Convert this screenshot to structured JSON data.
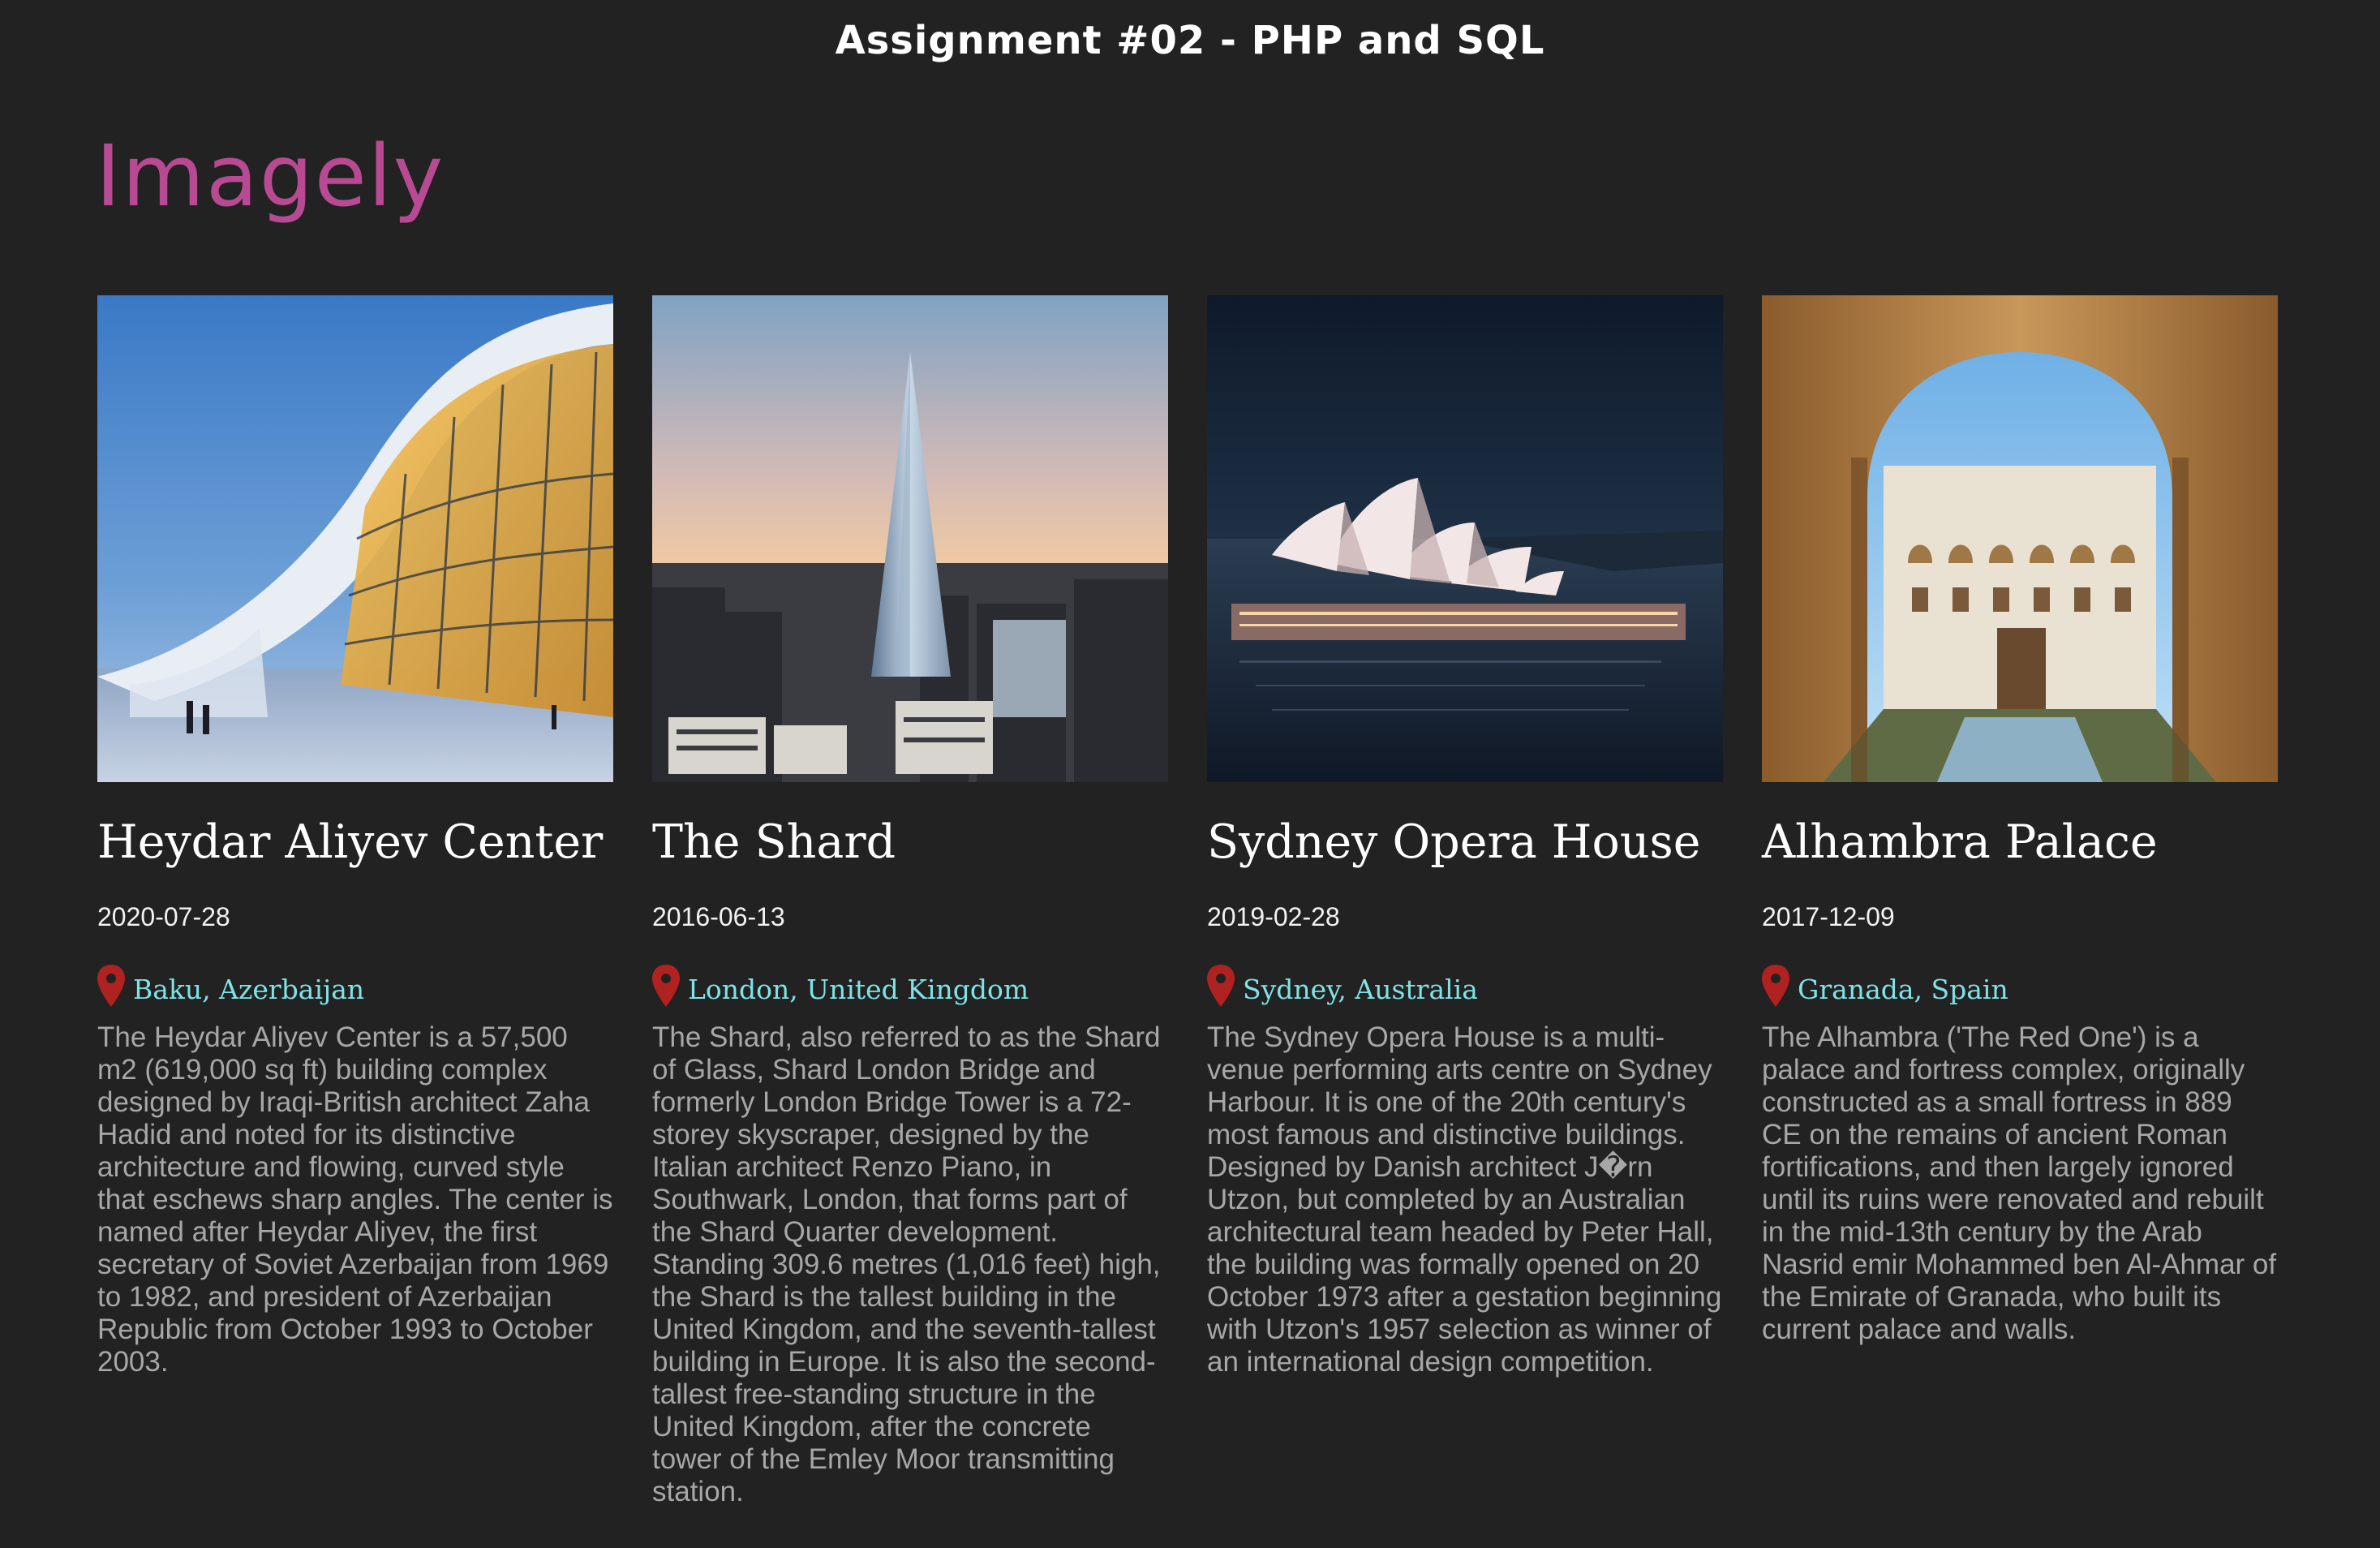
{
  "page": {
    "header": "Assignment #02 - PHP and SQL",
    "brand": "Imagely",
    "brand_color": "#b84a93",
    "location_color": "#7fe3e6",
    "pin_color": "#b0221f",
    "background": "#222222"
  },
  "cards": [
    {
      "title": "Heydar Aliyev Center",
      "date": "2020-07-28",
      "location": "Baku, Azerbaijan",
      "description": "The Heydar Aliyev Center is a 57,500 m2 (619,000 sq ft) building complex designed by Iraqi-British architect Zaha Hadid and noted for its distinctive architecture and flowing, curved style that eschews sharp angles. The center is named after Heydar Aliyev, the first secretary of Soviet Azerbaijan from 1969 to 1982, and president of Azerbaijan Republic from October 1993 to October 2003."
    },
    {
      "title": "The Shard",
      "date": "2016-06-13",
      "location": "London, United Kingdom",
      "description": "The Shard, also referred to as the Shard of Glass, Shard London Bridge and formerly London Bridge Tower is a 72-storey skyscraper, designed by the Italian architect Renzo Piano, in Southwark, London, that forms part of the Shard Quarter development. Standing 309.6 metres (1,016 feet) high, the Shard is the tallest building in the United Kingdom, and the seventh-tallest building in Europe. It is also the second-tallest free-standing structure in the United Kingdom, after the concrete tower of the Emley Moor transmitting station."
    },
    {
      "title": "Sydney Opera House",
      "date": "2019-02-28",
      "location": "Sydney, Australia",
      "description": "The Sydney Opera House is a multi-venue performing arts centre on Sydney Harbour. It is one of the 20th century's most famous and distinctive buildings. Designed by Danish architect J�rn Utzon, but completed by an Australian architectural team headed by Peter Hall, the building was formally opened on 20 October 1973 after a gestation beginning with Utzon's 1957 selection as winner of an international design competition."
    },
    {
      "title": "Alhambra Palace",
      "date": "2017-12-09",
      "location": "Granada, Spain",
      "description": "The Alhambra ('The Red One') is a palace and fortress complex, originally constructed as a small fortress in 889 CE on the remains of ancient Roman fortifications, and then largely ignored until its ruins were renovated and rebuilt in the mid-13th century by the Arab Nasrid emir Mohammed ben Al-Ahmar of the Emirate of Granada, who built its current palace and walls."
    }
  ]
}
